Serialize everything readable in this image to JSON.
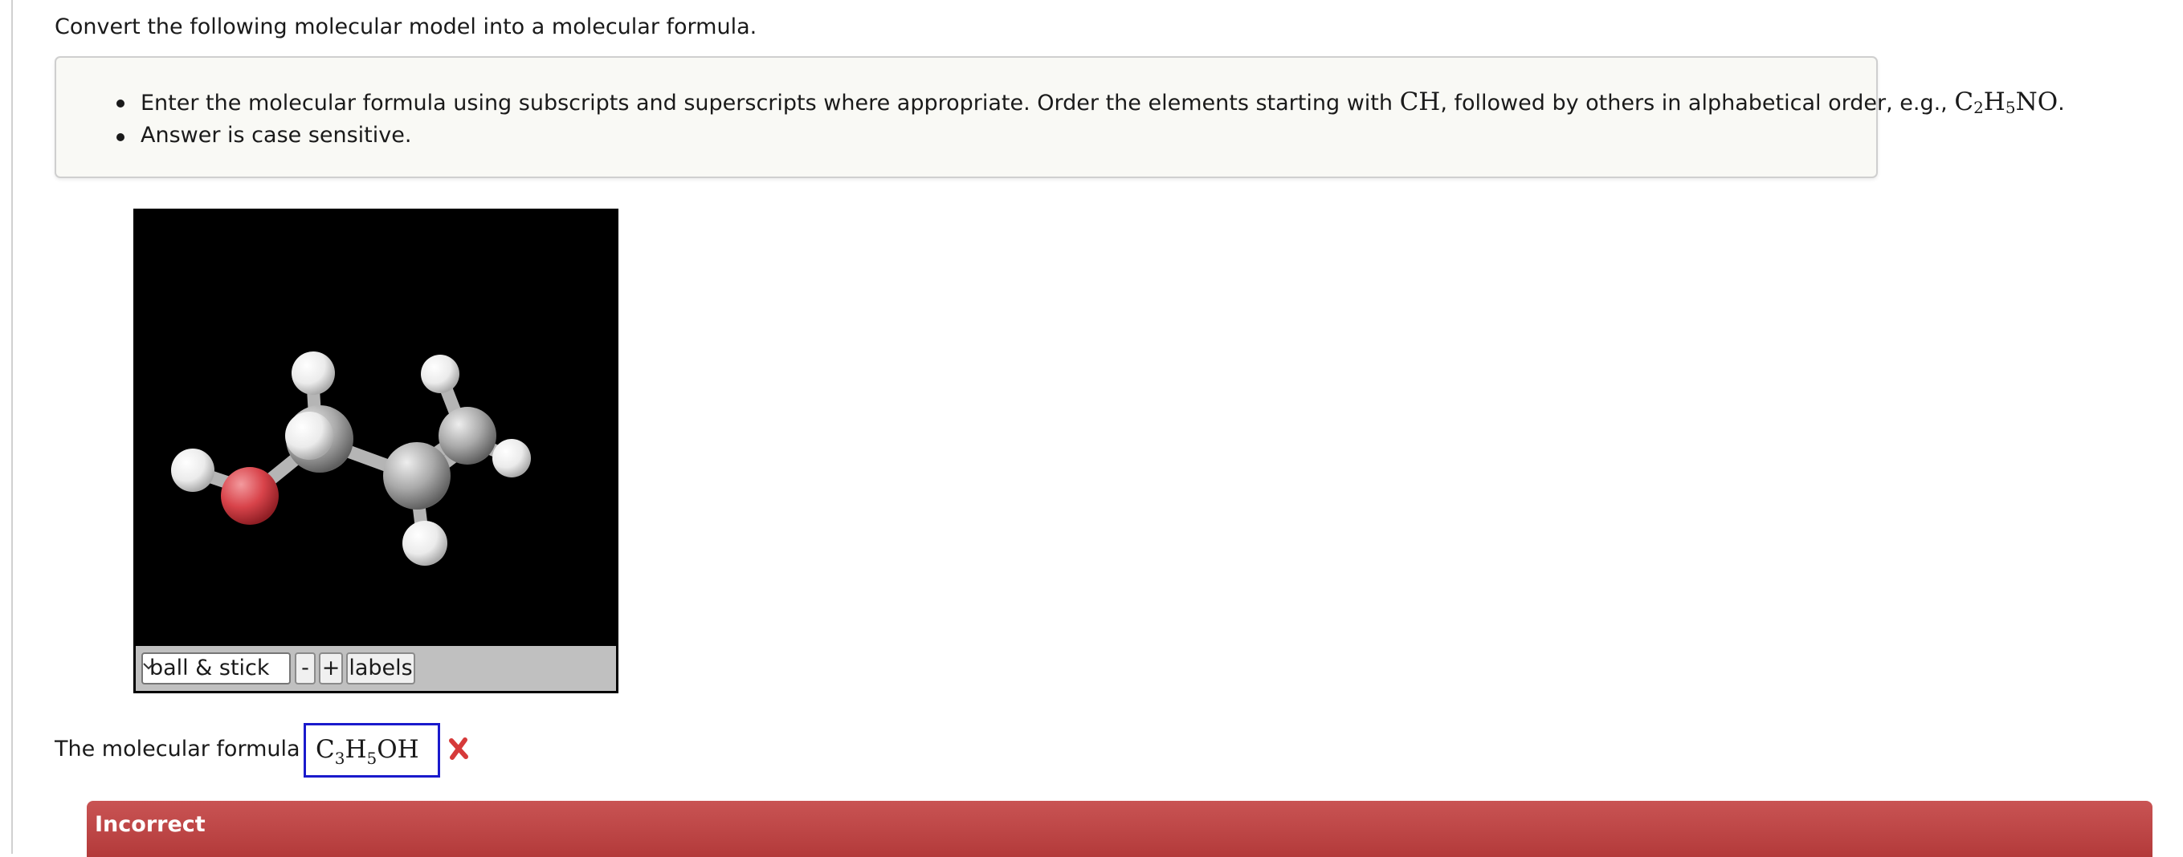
{
  "question": {
    "text": "Convert the following molecular model into a molecular formula."
  },
  "instructions": {
    "line1_before": "Enter the molecular formula using subscripts and superscripts where appropriate. Order the elements starting with ",
    "line1_ch": "CH",
    "line1_middle": ", followed by others in alphabetical order, e.g., ",
    "example": {
      "c": "C",
      "c_sub": "2",
      "h": "H",
      "h_sub": "5",
      "rest": "NO"
    },
    "line1_end": ".",
    "line2": "Answer is case sensitive."
  },
  "viewer": {
    "background": "#000000",
    "toolbar_color": "#c0c0c0",
    "model_select": {
      "selected": "ball & stick"
    },
    "zoom_out_label": "-",
    "zoom_in_label": "+",
    "labels_button": "labels",
    "atom_colors": {
      "oxygen": "#d8434a",
      "carbon": "#a8a8a8",
      "hydrogen": "#f2f2f2"
    }
  },
  "answer": {
    "label": "The molecular formula is",
    "value": {
      "p1": "C",
      "s1": "3",
      "p2": "H",
      "s2": "5",
      "p3": "OH"
    },
    "status_icon": "red-x-icon",
    "status_color": "#d63a3a"
  },
  "feedback": {
    "title": "Incorrect",
    "color": "#bb4444"
  }
}
